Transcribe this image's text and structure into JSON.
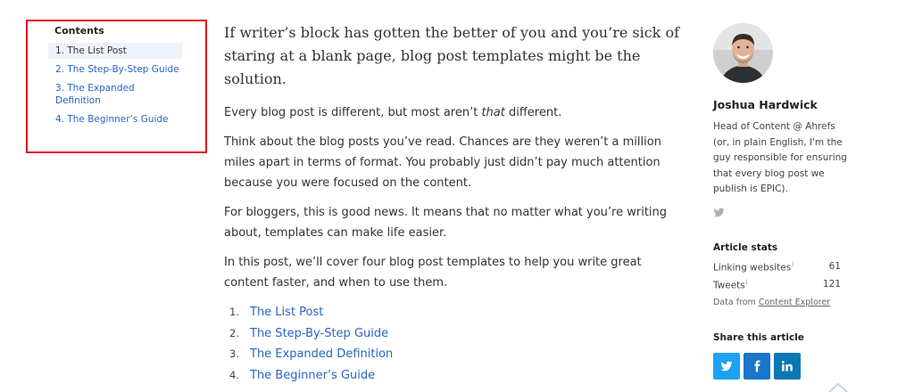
{
  "toc": {
    "title": "Contents",
    "items": [
      {
        "label": "1. The List Post"
      },
      {
        "label": "2. The Step-By-Step Guide"
      },
      {
        "label": "3. The Expanded Definition"
      },
      {
        "label": "4. The Beginner’s Guide"
      }
    ]
  },
  "article": {
    "lead": "If writer’s block has gotten the better of you and you’re sick of staring at a blank page, blog post templates might be the solution.",
    "p1_before": "Every blog post is different, but most aren’t ",
    "p1_em": "that",
    "p1_after": " different.",
    "p2": "Think about the blog posts you’ve read. Chances are they weren’t a million miles apart in terms of format. You probably just didn’t pay much attention because you were focused on the content.",
    "p3": "For bloggers, this is good news. It means that no matter what you’re writing about, templates can make life easier.",
    "p4": "In this post, we’ll cover four blog post templates to help you write great content faster, and when to use them.",
    "list": [
      {
        "num": "1.",
        "label": "The List Post"
      },
      {
        "num": "2.",
        "label": "The Step-By-Step Guide"
      },
      {
        "num": "3.",
        "label": "The Expanded Definition"
      },
      {
        "num": "4.",
        "label": "The Beginner’s Guide"
      }
    ]
  },
  "author": {
    "name": "Joshua Hardwick",
    "bio": "Head of Content @ Ahrefs (or, in plain English, I'm the guy responsible for ensuring that every blog post we publish is EPIC)."
  },
  "stats": {
    "heading": "Article stats",
    "rows": [
      {
        "label": "Linking websites",
        "sup": "i",
        "value": "61"
      },
      {
        "label": "Tweets",
        "sup": "i",
        "value": "121"
      }
    ],
    "from_prefix": "Data from ",
    "from_link": "Content Explorer"
  },
  "share": {
    "heading": "Share this article",
    "colors": {
      "twitter": "#1da1f2",
      "facebook": "#1877c9",
      "linkedin": "#0a77b5"
    }
  },
  "colors": {
    "link": "#2a64c5",
    "highlight_border": "#e0111b"
  }
}
